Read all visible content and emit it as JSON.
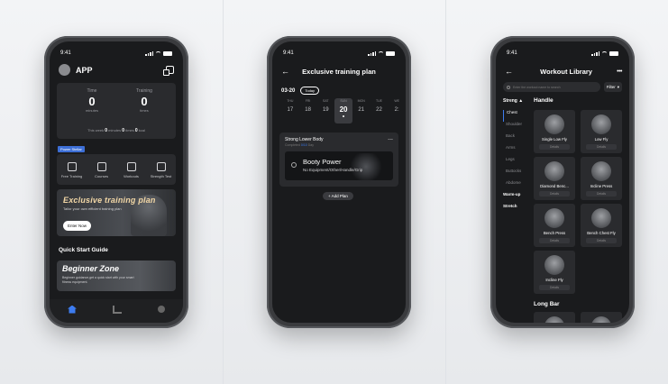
{
  "screen_home": {
    "status_time": "9:41",
    "app_name": "APP",
    "stats": {
      "time_label": "Time",
      "time_value": "0",
      "time_unit": "minutes",
      "training_label": "Training",
      "training_value": "0",
      "training_unit": "times",
      "week_prefix": "This week",
      "week_minutes": "0",
      "week_minutes_unit": "minutes",
      "week_times": "0",
      "week_times_unit": "times",
      "week_kcal": "0",
      "week_kcal_unit": "kcal"
    },
    "tag": "Power Stellar",
    "features": [
      "Free Training",
      "Courses",
      "Workouts",
      "Strength Test"
    ],
    "banner": {
      "title": "Exclusive training plan",
      "subtitle": "Tailor your own efficient training plan",
      "button": "Enter Now"
    },
    "quick_start_title": "Quick Start Guide",
    "beginner": {
      "title": "Beginner Zone",
      "subtitle": "Beginner guidance,get a quick start with your smart fitness equipment."
    }
  },
  "screen_plan": {
    "status_time": "9:41",
    "title": "Exclusive training plan",
    "date_range": "03-20",
    "today_button": "Today",
    "week_days": [
      {
        "name": "THU",
        "date": "17"
      },
      {
        "name": "FRI",
        "date": "18"
      },
      {
        "name": "SAT",
        "date": "19"
      },
      {
        "name": "SUN",
        "date": "20",
        "selected": true
      },
      {
        "name": "MON",
        "date": "21"
      },
      {
        "name": "TUE",
        "date": "22"
      },
      {
        "name": "WE",
        "date": "2:"
      }
    ],
    "plan": {
      "name": "Strong Lower Body",
      "progress_prefix": "Completed",
      "progress_value": "0/10",
      "progress_unit": "Day",
      "menu": "...",
      "workout_title": "Booty Power",
      "workout_sub": "No Equipment/Other/Handle/Grip"
    },
    "add_plan_button": "+ Add Plan"
  },
  "screen_library": {
    "status_time": "9:41",
    "title": "Workout Library",
    "more": "•••",
    "search_placeholder": "Enter the workout name to search",
    "filter_label": "Filter",
    "sidebar_header": "Streng ▲",
    "sidebar_items": [
      "Chest",
      "Shoulder",
      "Back",
      "Arms",
      "Legs",
      "Buttocks",
      "Abdome"
    ],
    "sidebar_extra": [
      "Warm-up",
      "Stretch"
    ],
    "group_title": "Handle",
    "cards": [
      {
        "name": "Single Low Fly",
        "detail": "Details"
      },
      {
        "name": "Low Fly",
        "detail": "Details"
      },
      {
        "name": "Diamond Benc...",
        "detail": "Details"
      },
      {
        "name": "Incline Press",
        "detail": "Details"
      },
      {
        "name": "Bench Press",
        "detail": "Details"
      },
      {
        "name": "Bench Chest Fly",
        "detail": "Details"
      },
      {
        "name": "Incline Fly",
        "detail": "Details"
      }
    ],
    "group2_title": "Long Bar"
  },
  "colors": {
    "accent": "#3d7cf0",
    "screen_bg": "#1a1b1d",
    "card_bg": "#2a2b2e",
    "banner_title": "#f2d7a6"
  }
}
